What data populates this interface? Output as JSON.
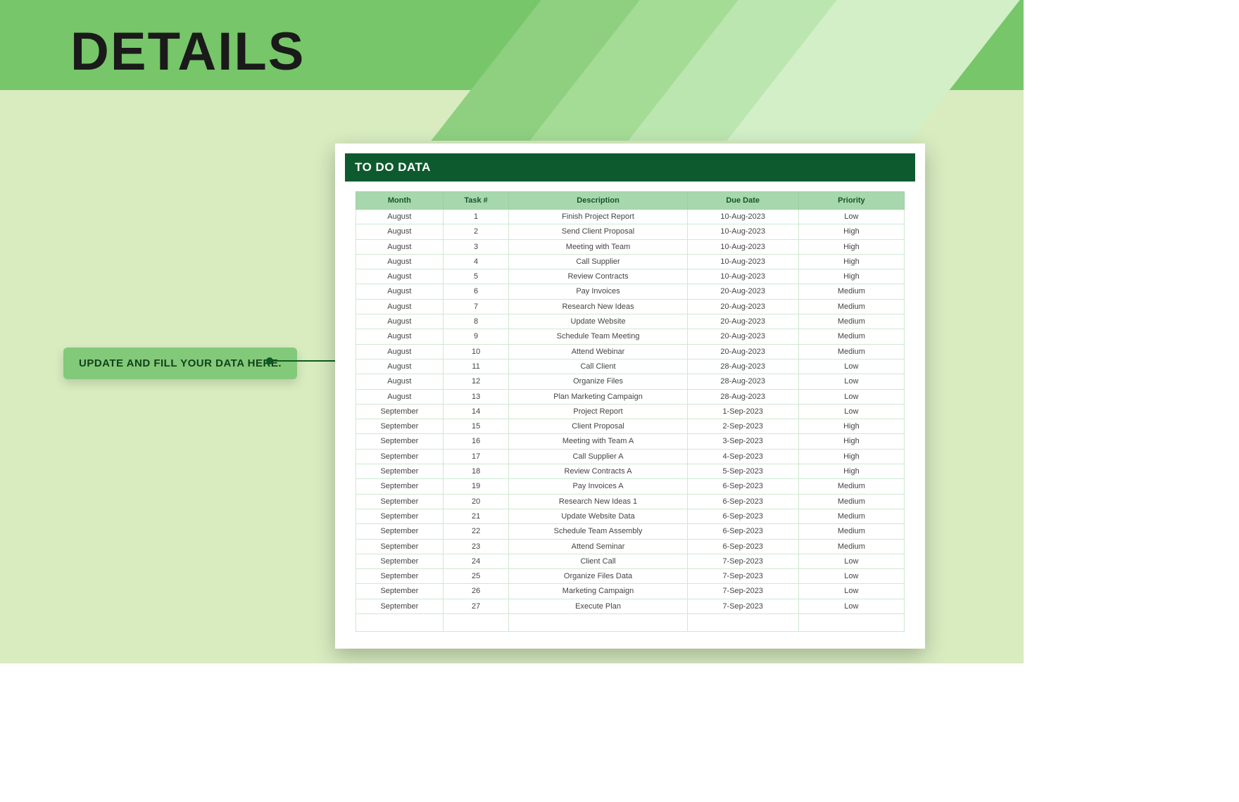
{
  "header": {
    "title": "DETAILS"
  },
  "callout": {
    "text": "UPDATE AND FILL YOUR DATA HERE."
  },
  "card": {
    "title": "TO DO DATA"
  },
  "table": {
    "headers": {
      "month": "Month",
      "task": "Task #",
      "desc": "Description",
      "due": "Due Date",
      "pri": "Priority"
    },
    "rows": [
      {
        "month": "August",
        "task": "1",
        "desc": "Finish Project Report",
        "due": "10-Aug-2023",
        "pri": "Low"
      },
      {
        "month": "August",
        "task": "2",
        "desc": "Send Client Proposal",
        "due": "10-Aug-2023",
        "pri": "High"
      },
      {
        "month": "August",
        "task": "3",
        "desc": "Meeting with Team",
        "due": "10-Aug-2023",
        "pri": "High"
      },
      {
        "month": "August",
        "task": "4",
        "desc": "Call Supplier",
        "due": "10-Aug-2023",
        "pri": "High"
      },
      {
        "month": "August",
        "task": "5",
        "desc": "Review Contracts",
        "due": "10-Aug-2023",
        "pri": "High"
      },
      {
        "month": "August",
        "task": "6",
        "desc": "Pay Invoices",
        "due": "20-Aug-2023",
        "pri": "Medium"
      },
      {
        "month": "August",
        "task": "7",
        "desc": "Research New Ideas",
        "due": "20-Aug-2023",
        "pri": "Medium"
      },
      {
        "month": "August",
        "task": "8",
        "desc": "Update Website",
        "due": "20-Aug-2023",
        "pri": "Medium"
      },
      {
        "month": "August",
        "task": "9",
        "desc": "Schedule Team Meeting",
        "due": "20-Aug-2023",
        "pri": "Medium"
      },
      {
        "month": "August",
        "task": "10",
        "desc": "Attend Webinar",
        "due": "20-Aug-2023",
        "pri": "Medium"
      },
      {
        "month": "August",
        "task": "11",
        "desc": "Call Client",
        "due": "28-Aug-2023",
        "pri": "Low"
      },
      {
        "month": "August",
        "task": "12",
        "desc": "Organize Files",
        "due": "28-Aug-2023",
        "pri": "Low"
      },
      {
        "month": "August",
        "task": "13",
        "desc": "Plan Marketing Campaign",
        "due": "28-Aug-2023",
        "pri": "Low"
      },
      {
        "month": "September",
        "task": "14",
        "desc": "Project Report",
        "due": "1-Sep-2023",
        "pri": "Low"
      },
      {
        "month": "September",
        "task": "15",
        "desc": "Client Proposal",
        "due": "2-Sep-2023",
        "pri": "High"
      },
      {
        "month": "September",
        "task": "16",
        "desc": "Meeting with Team A",
        "due": "3-Sep-2023",
        "pri": "High"
      },
      {
        "month": "September",
        "task": "17",
        "desc": "Call Supplier A",
        "due": "4-Sep-2023",
        "pri": "High"
      },
      {
        "month": "September",
        "task": "18",
        "desc": "Review Contracts A",
        "due": "5-Sep-2023",
        "pri": "High"
      },
      {
        "month": "September",
        "task": "19",
        "desc": "Pay Invoices A",
        "due": "6-Sep-2023",
        "pri": "Medium"
      },
      {
        "month": "September",
        "task": "20",
        "desc": "Research New Ideas 1",
        "due": "6-Sep-2023",
        "pri": "Medium"
      },
      {
        "month": "September",
        "task": "21",
        "desc": "Update Website Data",
        "due": "6-Sep-2023",
        "pri": "Medium"
      },
      {
        "month": "September",
        "task": "22",
        "desc": "Schedule Team Assembly",
        "due": "6-Sep-2023",
        "pri": "Medium"
      },
      {
        "month": "September",
        "task": "23",
        "desc": "Attend Seminar",
        "due": "6-Sep-2023",
        "pri": "Medium"
      },
      {
        "month": "September",
        "task": "24",
        "desc": "Client Call",
        "due": "7-Sep-2023",
        "pri": "Low"
      },
      {
        "month": "September",
        "task": "25",
        "desc": "Organize Files Data",
        "due": "7-Sep-2023",
        "pri": "Low"
      },
      {
        "month": "September",
        "task": "26",
        "desc": "Marketing Campaign",
        "due": "7-Sep-2023",
        "pri": "Low"
      },
      {
        "month": "September",
        "task": "27",
        "desc": "Execute Plan",
        "due": "7-Sep-2023",
        "pri": "Low"
      }
    ]
  }
}
